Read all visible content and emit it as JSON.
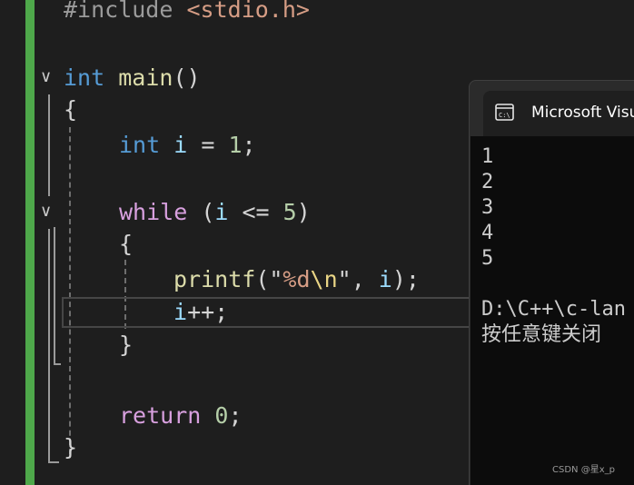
{
  "editor": {
    "include_directive": "#include",
    "include_header": "<stdio.h>",
    "main_type": "int",
    "main_name": "main",
    "main_parens": "()",
    "brace_open": "{",
    "brace_close": "}",
    "decl_type": "int",
    "decl_var": "i",
    "decl_assign": " = ",
    "decl_value": "1",
    "semicolon": ";",
    "while_kw": "while",
    "while_open": " (",
    "while_var": "i",
    "while_op": " <= ",
    "while_limit": "5",
    "while_close": ")",
    "printf_name": "printf",
    "printf_open": "(\"",
    "printf_format": "%d",
    "printf_escape": "\\n",
    "printf_mid": "\", ",
    "printf_var": "i",
    "printf_close": ");",
    "incr_var": "i",
    "incr_op": "++;",
    "return_kw": "return",
    "return_value": "0",
    "fold_glyph": "∨",
    "colors": {
      "change_bar": "#4ea84a",
      "keyword": "#569cd6",
      "control": "#d8a0df",
      "function": "#dcdcaa",
      "variable": "#9cdcfe",
      "number": "#b5cea8",
      "string": "#d69d85"
    }
  },
  "console": {
    "icon": "console-app-icon",
    "icon_text": "C:\\",
    "title": "Microsoft Visu",
    "output_lines": [
      "1",
      "2",
      "3",
      "4",
      "5"
    ],
    "path_line": "D:\\C++\\c-lan",
    "prompt_line": "按任意键关闭"
  },
  "watermark": "CSDN @星x_p"
}
